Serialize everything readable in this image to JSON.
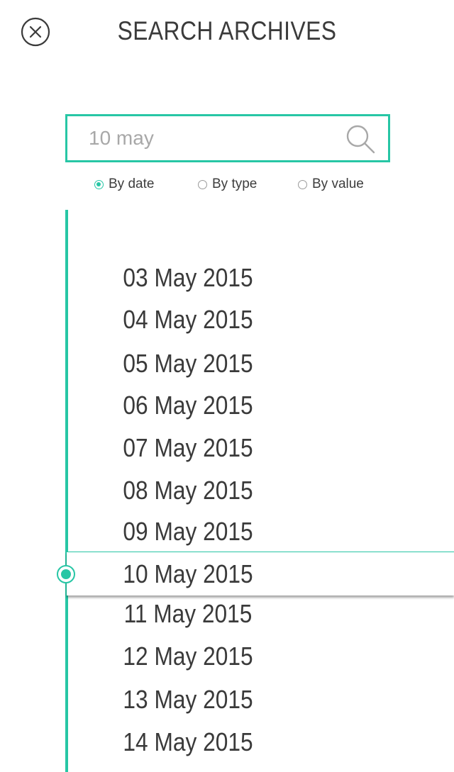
{
  "header": {
    "title": "SEARCH ARCHIVES",
    "close_icon": "close-circle-icon"
  },
  "search": {
    "value": "10 may",
    "icon": "search-icon"
  },
  "filters": [
    {
      "label": "By date",
      "checked": true
    },
    {
      "label": "By type",
      "checked": false
    },
    {
      "label": "By value",
      "checked": false
    }
  ],
  "accent_color": "#27c6a5",
  "timeline": {
    "selected_index": 7,
    "dates": [
      "03 May 2015",
      "04 May 2015",
      "05 May 2015",
      "06 May 2015",
      "07 May 2015",
      "08 May 2015",
      "09 May 2015",
      "10 May 2015",
      "11 May 2015",
      "12 May 2015",
      "13 May 2015",
      "14 May 2015"
    ]
  }
}
